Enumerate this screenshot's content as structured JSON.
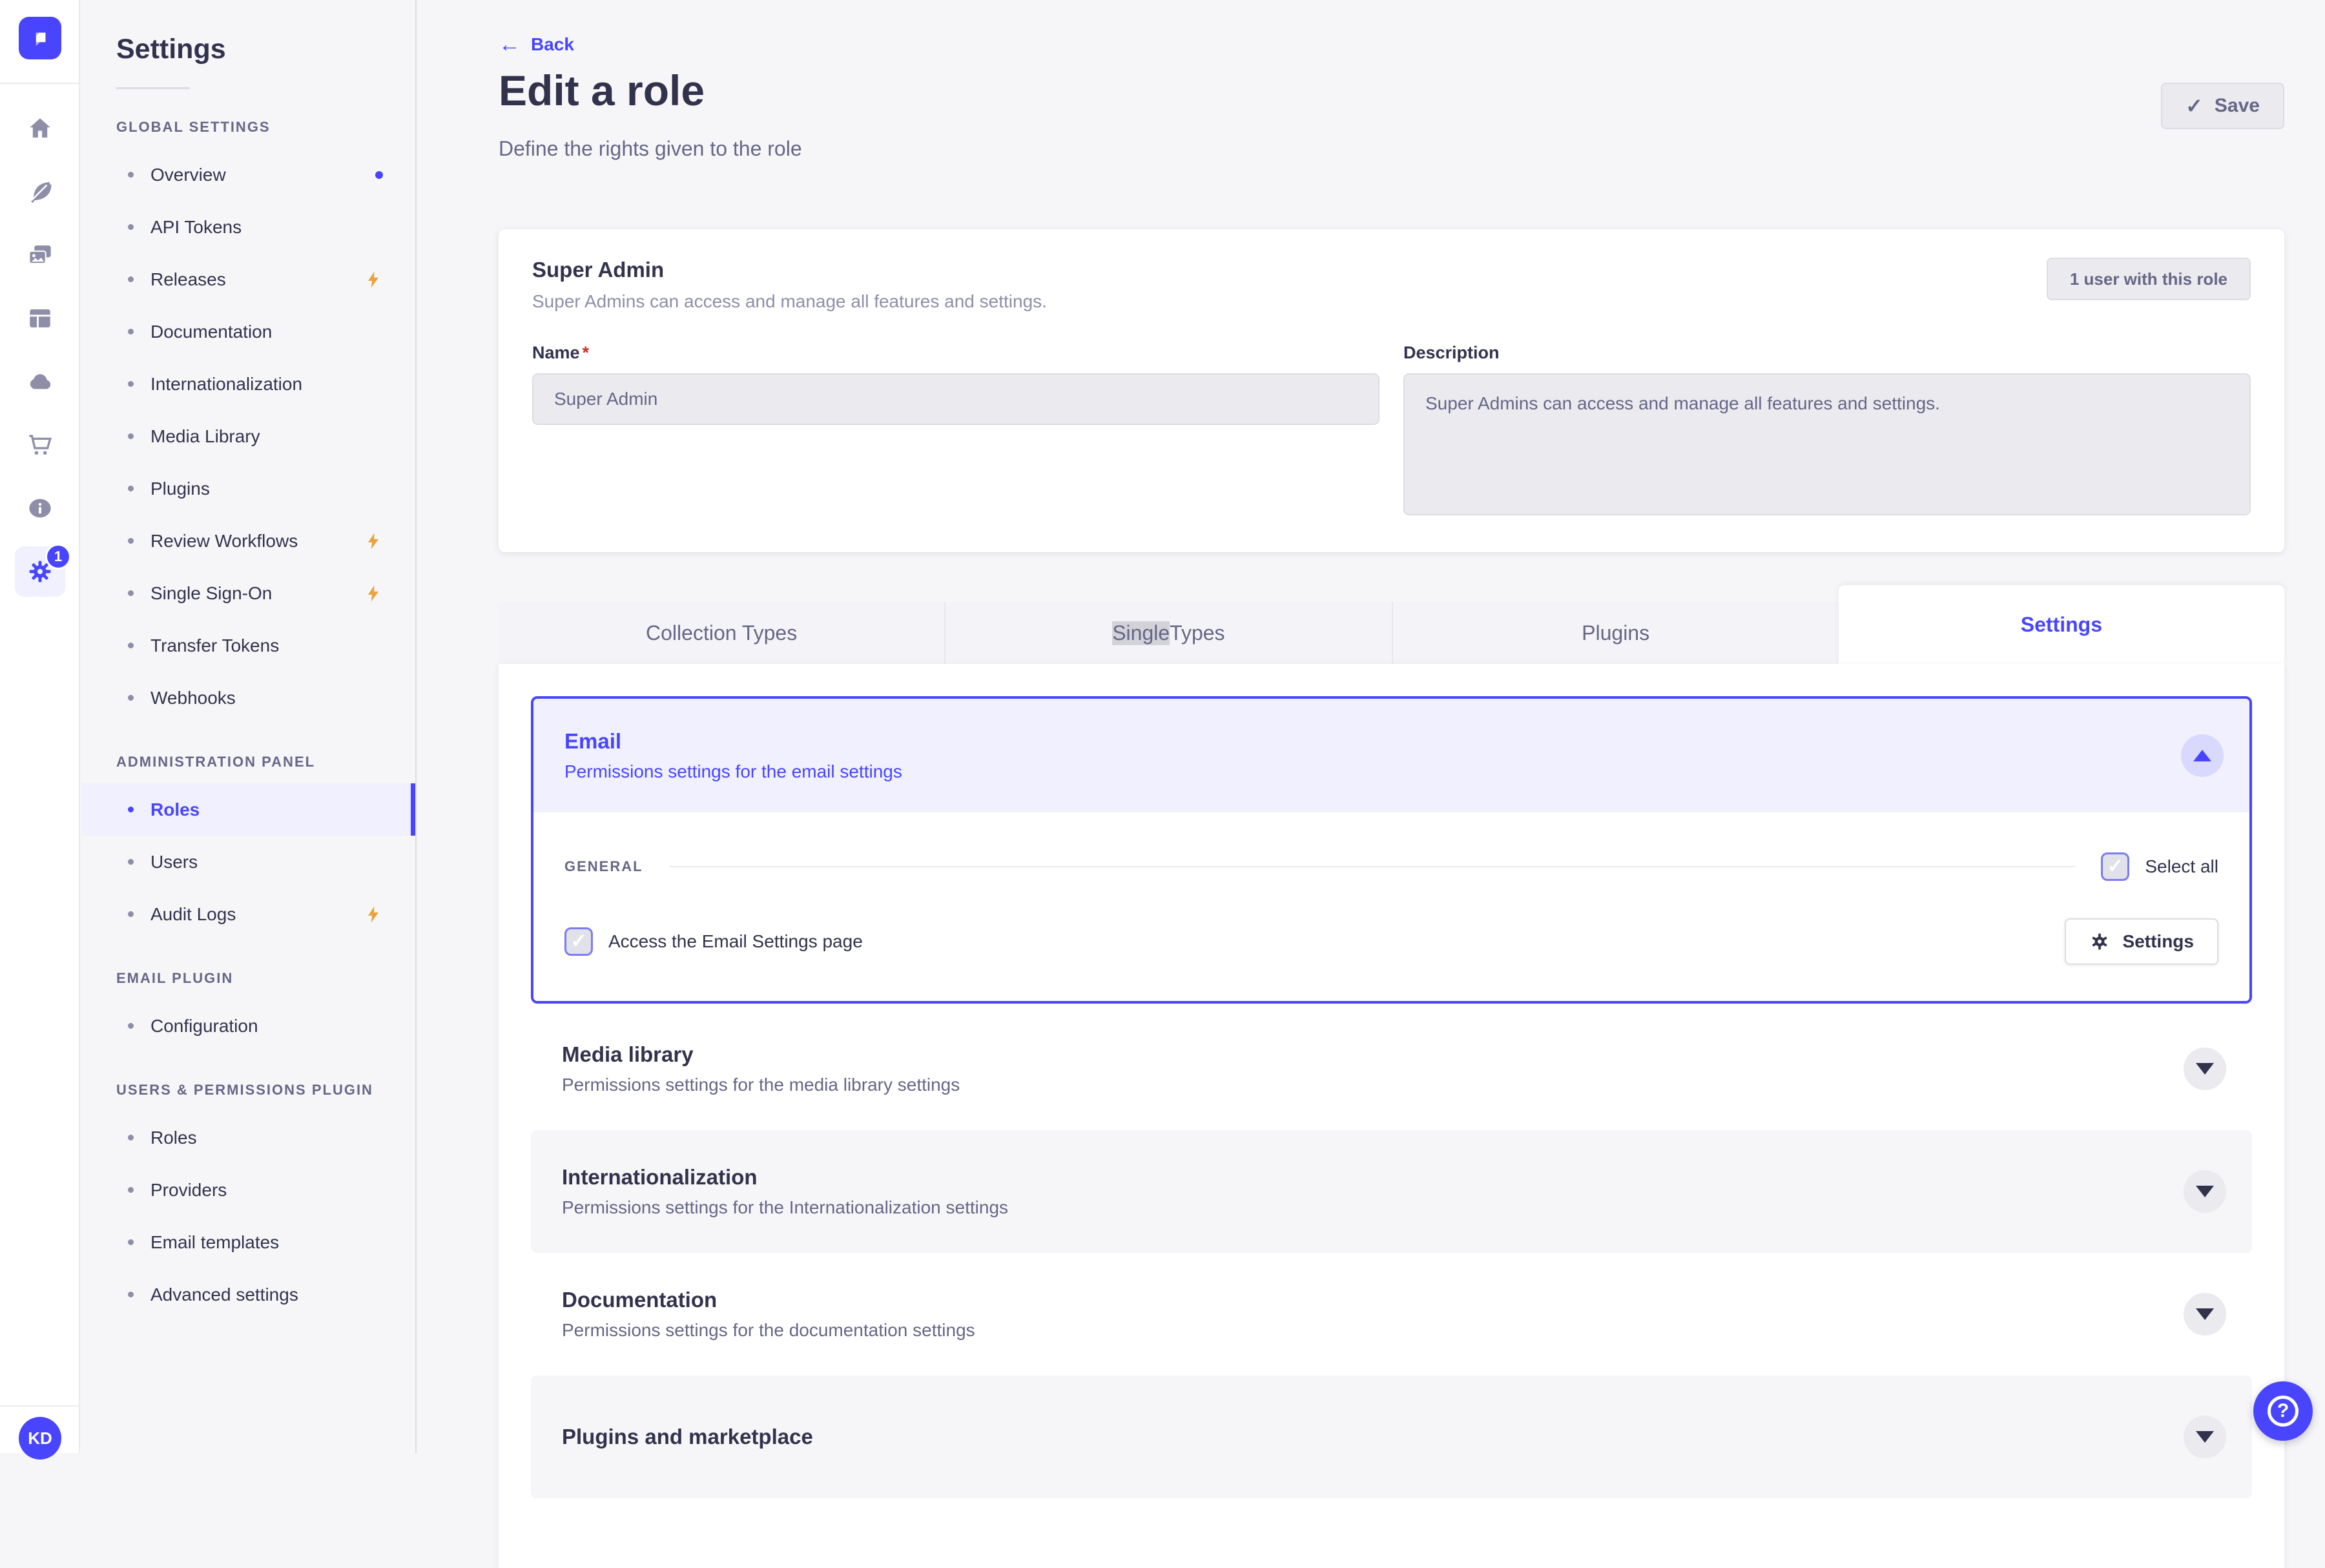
{
  "colors": {
    "accent": "#4945ff",
    "accent_bg": "#f0f0ff",
    "lightning": "#e8a33d",
    "danger": "#d02b20",
    "text_dark": "#32324d",
    "text_gray": "#666687"
  },
  "nav_rail": {
    "logo_icon": "strapi-logo",
    "icons": [
      "home-icon",
      "feather-icon",
      "media-library-icon",
      "layout-icon",
      "cloud-icon",
      "marketplace-cart-icon",
      "info-icon",
      "settings-gear-icon"
    ],
    "settings_badge": "1",
    "avatar_initials": "KD"
  },
  "sidebar": {
    "title": "Settings",
    "sections": [
      {
        "label": "GLOBAL SETTINGS",
        "items": [
          {
            "label": "Overview",
            "badge": "dot"
          },
          {
            "label": "API Tokens",
            "badge": ""
          },
          {
            "label": "Releases",
            "badge": "lightning"
          },
          {
            "label": "Documentation",
            "badge": ""
          },
          {
            "label": "Internationalization",
            "badge": ""
          },
          {
            "label": "Media Library",
            "badge": ""
          },
          {
            "label": "Plugins",
            "badge": ""
          },
          {
            "label": "Review Workflows",
            "badge": "lightning"
          },
          {
            "label": "Single Sign-On",
            "badge": "lightning"
          },
          {
            "label": "Transfer Tokens",
            "badge": ""
          },
          {
            "label": "Webhooks",
            "badge": ""
          }
        ]
      },
      {
        "label": "ADMINISTRATION PANEL",
        "items": [
          {
            "label": "Roles",
            "active": true,
            "badge": ""
          },
          {
            "label": "Users",
            "badge": ""
          },
          {
            "label": "Audit Logs",
            "badge": "lightning"
          }
        ]
      },
      {
        "label": "EMAIL PLUGIN",
        "items": [
          {
            "label": "Configuration",
            "badge": ""
          }
        ]
      },
      {
        "label": "USERS & PERMISSIONS PLUGIN",
        "items": [
          {
            "label": "Roles",
            "badge": ""
          },
          {
            "label": "Providers",
            "badge": ""
          },
          {
            "label": "Email templates",
            "badge": ""
          },
          {
            "label": "Advanced settings",
            "badge": ""
          }
        ]
      }
    ]
  },
  "header": {
    "back_label": "Back",
    "title": "Edit a role",
    "subtitle": "Define the rights given to the role",
    "save_label": "Save"
  },
  "role_card": {
    "heading": "Super Admin",
    "subheading": "Super Admins can access and manage all features and settings.",
    "users_count_button": "1 user with this role",
    "name_label": "Name",
    "required_asterisk": "*",
    "name_value": "Super Admin",
    "description_label": "Description",
    "description_value": "Super Admins can access and manage all features and settings."
  },
  "tabs": {
    "collection_types": "Collection Types",
    "single_highlight": "Single",
    "single_rest": " Types",
    "plugins": "Plugins",
    "settings": "Settings"
  },
  "permissions": {
    "email": {
      "title": "Email",
      "subtitle": "Permissions settings for the email settings",
      "section_label": "GENERAL",
      "select_all_label": "Select all",
      "permission_label": "Access the Email Settings page",
      "settings_button_label": "Settings"
    },
    "accordions": [
      {
        "title": "Media library",
        "subtitle": "Permissions settings for the media library settings"
      },
      {
        "title": "Internationalization",
        "subtitle": "Permissions settings for the Internationalization settings"
      },
      {
        "title": "Documentation",
        "subtitle": "Permissions settings for the documentation settings"
      },
      {
        "title": "Plugins and marketplace",
        "subtitle": ""
      }
    ]
  },
  "help": {
    "icon": "question-mark-icon"
  }
}
